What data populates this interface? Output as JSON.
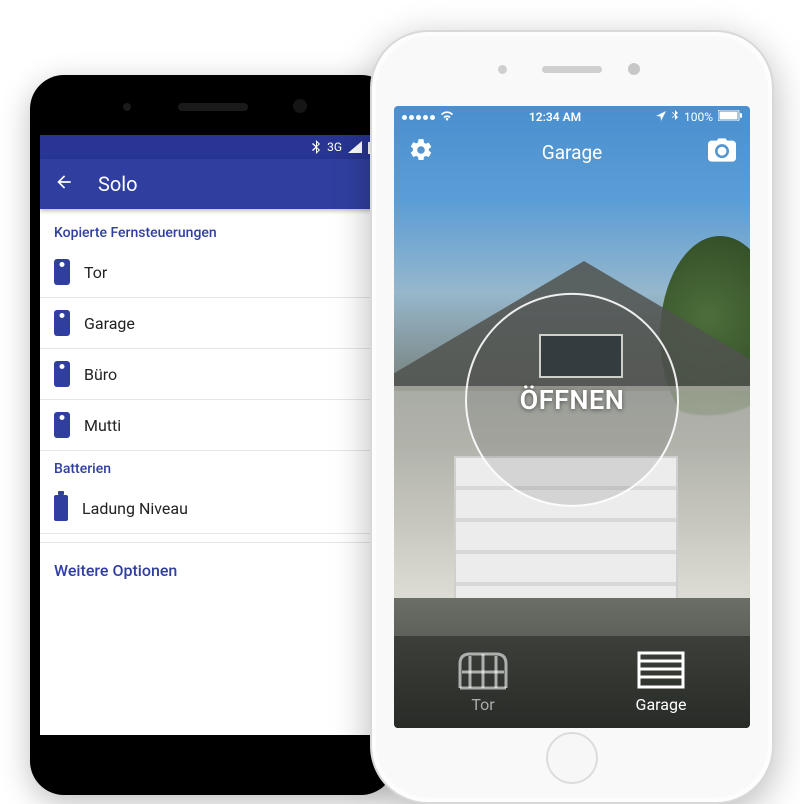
{
  "android": {
    "status": {
      "network_label": "3G"
    },
    "appbar": {
      "title": "Solo"
    },
    "sections": {
      "copied": {
        "header": "Kopierte Fernsteuerungen",
        "items": [
          "Tor",
          "Garage",
          "Büro",
          "Mutti"
        ]
      },
      "batteries": {
        "header": "Batterien",
        "item": "Ladung Niveau"
      }
    },
    "more_options": "Weitere Optionen"
  },
  "ios": {
    "status": {
      "time": "12:34 AM",
      "battery": "100%"
    },
    "toolbar": {
      "title": "Garage"
    },
    "open_button": "ÖFFNEN",
    "tabs": {
      "gate": "Tor",
      "garage": "Garage"
    }
  }
}
